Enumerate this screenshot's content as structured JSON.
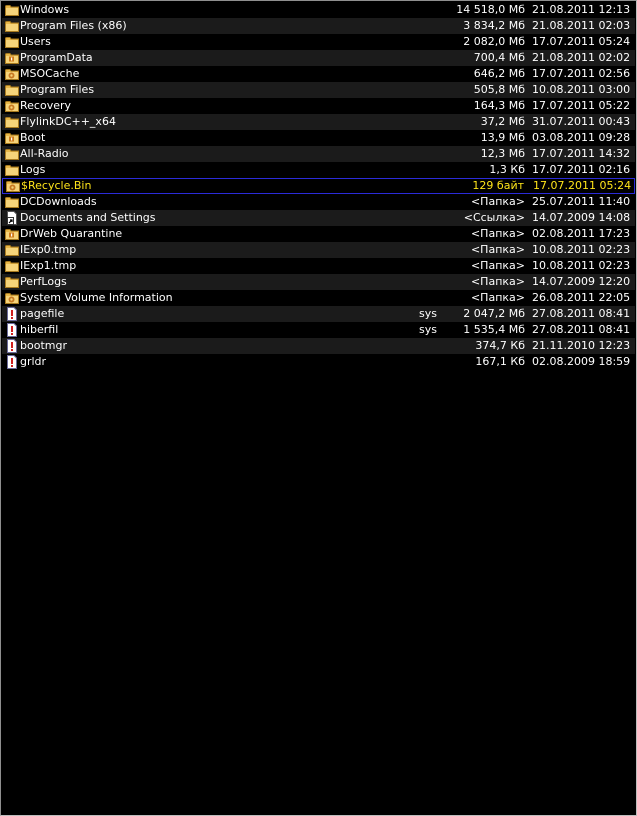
{
  "files": [
    {
      "name": "Windows",
      "attr": "",
      "size": "14 518,0 Мб",
      "date": "21.08.2011 12:13",
      "icon": "folder-icon"
    },
    {
      "name": "Program Files (x86)",
      "attr": "",
      "size": "3 834,2 Мб",
      "date": "21.08.2011 02:03",
      "icon": "folder-icon"
    },
    {
      "name": "Users",
      "attr": "",
      "size": "2 082,0 Мб",
      "date": "17.07.2011 05:24",
      "icon": "folder-icon"
    },
    {
      "name": "ProgramData",
      "attr": "",
      "size": "700,4 Мб",
      "date": "21.08.2011 02:02",
      "icon": "hidden-folder-icon"
    },
    {
      "name": "MSOCache",
      "attr": "",
      "size": "646,2 Мб",
      "date": "17.07.2011 02:56",
      "icon": "system-folder-icon"
    },
    {
      "name": "Program Files",
      "attr": "",
      "size": "505,8 Мб",
      "date": "10.08.2011 03:00",
      "icon": "folder-icon"
    },
    {
      "name": "Recovery",
      "attr": "",
      "size": "164,3 Мб",
      "date": "17.07.2011 05:22",
      "icon": "system-folder-icon"
    },
    {
      "name": "FlylinkDC++_x64",
      "attr": "",
      "size": "37,2 Мб",
      "date": "31.07.2011 00:43",
      "icon": "folder-icon"
    },
    {
      "name": "Boot",
      "attr": "",
      "size": "13,9 Мб",
      "date": "03.08.2011 09:28",
      "icon": "hidden-folder-icon"
    },
    {
      "name": "All-Radio",
      "attr": "",
      "size": "12,3 Мб",
      "date": "17.07.2011 14:32",
      "icon": "folder-icon"
    },
    {
      "name": "Logs",
      "attr": "",
      "size": "1,3 Кб",
      "date": "17.07.2011 02:16",
      "icon": "folder-icon"
    },
    {
      "name": "$Recycle.Bin",
      "attr": "",
      "size": "129 байт",
      "date": "17.07.2011 05:24",
      "icon": "system-folder-icon"
    },
    {
      "name": "DCDownloads",
      "attr": "",
      "size": "<Папка>",
      "date": "25.07.2011 11:40",
      "icon": "folder-icon"
    },
    {
      "name": "Documents and Settings",
      "attr": "",
      "size": "<Ссылка>",
      "date": "14.07.2009 14:08",
      "icon": "link-icon"
    },
    {
      "name": "DrWeb Quarantine",
      "attr": "",
      "size": "<Папка>",
      "date": "02.08.2011 17:23",
      "icon": "hidden-folder-icon"
    },
    {
      "name": "IExp0.tmp",
      "attr": "",
      "size": "<Папка>",
      "date": "10.08.2011 02:23",
      "icon": "folder-icon"
    },
    {
      "name": "IExp1.tmp",
      "attr": "",
      "size": "<Папка>",
      "date": "10.08.2011 02:23",
      "icon": "folder-icon"
    },
    {
      "name": "PerfLogs",
      "attr": "",
      "size": "<Папка>",
      "date": "14.07.2009 12:20",
      "icon": "folder-icon"
    },
    {
      "name": "System Volume Information",
      "attr": "",
      "size": "<Папка>",
      "date": "26.08.2011 22:05",
      "icon": "system-folder-icon"
    },
    {
      "name": "pagefile",
      "attr": "sys",
      "size": "2 047,2 Мб",
      "date": "27.08.2011 08:41",
      "icon": "system-file-icon"
    },
    {
      "name": "hiberfil",
      "attr": "sys",
      "size": "1 535,4 Мб",
      "date": "27.08.2011 08:41",
      "icon": "system-file-icon"
    },
    {
      "name": "bootmgr",
      "attr": "",
      "size": "374,7 Кб",
      "date": "21.11.2010 12:23",
      "icon": "system-file-icon"
    },
    {
      "name": "grldr",
      "attr": "",
      "size": "167,1 Кб",
      "date": "02.08.2009 18:59",
      "icon": "system-file-icon"
    }
  ],
  "selected_index": 11,
  "colors": {
    "background": "#000000",
    "alt_row": "#1b1b1b",
    "text": "#ffffff",
    "selected_text": "#ffe51a",
    "selection_border": "#2b2bd8",
    "folder": "#e8b84a"
  }
}
